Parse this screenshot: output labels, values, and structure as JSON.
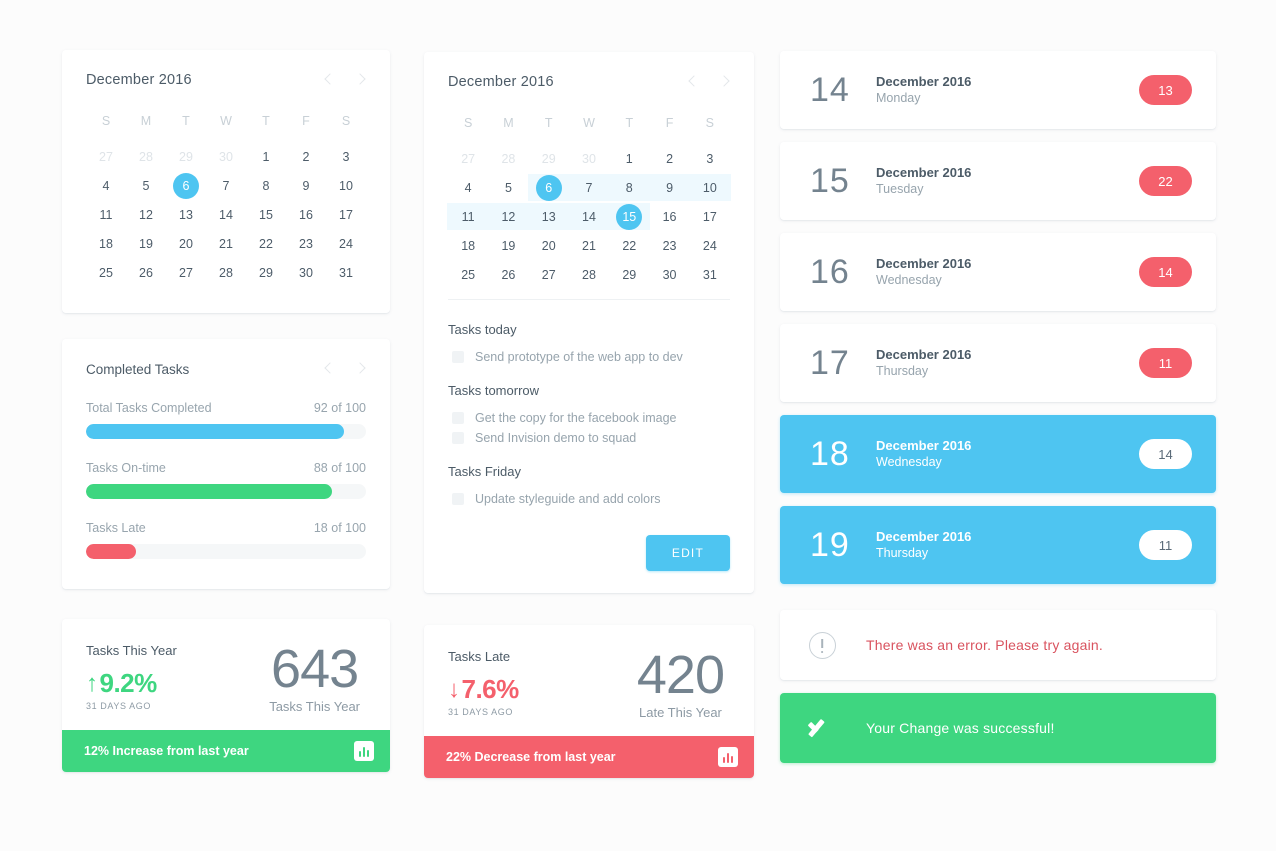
{
  "calendar_simple": {
    "title": "December 2016",
    "prev_icon": "chevron-left-icon",
    "next_icon": "chevron-right-icon",
    "dow": [
      "S",
      "M",
      "T",
      "W",
      "T",
      "F",
      "S"
    ],
    "weeks": [
      [
        {
          "d": "27",
          "muted": true
        },
        {
          "d": "28",
          "muted": true
        },
        {
          "d": "29",
          "muted": true
        },
        {
          "d": "30",
          "muted": true
        },
        {
          "d": "1"
        },
        {
          "d": "2"
        },
        {
          "d": "3"
        }
      ],
      [
        {
          "d": "4"
        },
        {
          "d": "5"
        },
        {
          "d": "6",
          "sel": true
        },
        {
          "d": "7"
        },
        {
          "d": "8"
        },
        {
          "d": "9"
        },
        {
          "d": "10"
        }
      ],
      [
        {
          "d": "11"
        },
        {
          "d": "12"
        },
        {
          "d": "13"
        },
        {
          "d": "14"
        },
        {
          "d": "15"
        },
        {
          "d": "16"
        },
        {
          "d": "17"
        }
      ],
      [
        {
          "d": "18"
        },
        {
          "d": "19"
        },
        {
          "d": "20"
        },
        {
          "d": "21"
        },
        {
          "d": "22"
        },
        {
          "d": "23"
        },
        {
          "d": "24"
        }
      ],
      [
        {
          "d": "25"
        },
        {
          "d": "26"
        },
        {
          "d": "27"
        },
        {
          "d": "28"
        },
        {
          "d": "29"
        },
        {
          "d": "30"
        },
        {
          "d": "31"
        }
      ]
    ]
  },
  "calendar_range": {
    "title": "December 2016",
    "prev_icon": "chevron-left-icon",
    "next_icon": "chevron-right-icon",
    "dow": [
      "S",
      "M",
      "T",
      "W",
      "T",
      "F",
      "S"
    ],
    "range_start": "6",
    "range_end": "15",
    "weeks": [
      [
        {
          "d": "27",
          "muted": true
        },
        {
          "d": "28",
          "muted": true
        },
        {
          "d": "29",
          "muted": true
        },
        {
          "d": "30",
          "muted": true
        },
        {
          "d": "1"
        },
        {
          "d": "2"
        },
        {
          "d": "3"
        }
      ],
      [
        {
          "d": "4"
        },
        {
          "d": "5"
        },
        {
          "d": "6",
          "sel": true,
          "range": true
        },
        {
          "d": "7",
          "range": true
        },
        {
          "d": "8",
          "range": true
        },
        {
          "d": "9",
          "range": true
        },
        {
          "d": "10",
          "range": true
        }
      ],
      [
        {
          "d": "11",
          "range": true
        },
        {
          "d": "12",
          "range": true
        },
        {
          "d": "13",
          "range": true
        },
        {
          "d": "14",
          "range": true
        },
        {
          "d": "15",
          "sel": true,
          "range": true
        },
        {
          "d": "16"
        },
        {
          "d": "17"
        }
      ],
      [
        {
          "d": "18"
        },
        {
          "d": "19"
        },
        {
          "d": "20"
        },
        {
          "d": "21"
        },
        {
          "d": "22"
        },
        {
          "d": "23"
        },
        {
          "d": "24"
        }
      ],
      [
        {
          "d": "25"
        },
        {
          "d": "26"
        },
        {
          "d": "27"
        },
        {
          "d": "28"
        },
        {
          "d": "29"
        },
        {
          "d": "30"
        },
        {
          "d": "31"
        }
      ]
    ]
  },
  "task_panel": {
    "groups": [
      {
        "title": "Tasks today",
        "items": [
          {
            "label": "Send prototype of the web app to dev",
            "checked": false
          }
        ]
      },
      {
        "title": "Tasks tomorrow",
        "items": [
          {
            "label": "Get the copy for the facebook image",
            "checked": false
          },
          {
            "label": "Send Invision demo to squad",
            "checked": false
          }
        ]
      },
      {
        "title": "Tasks Friday",
        "items": [
          {
            "label": "Update styleguide and add colors",
            "checked": false
          }
        ]
      }
    ],
    "edit_button": "EDIT"
  },
  "completed_tasks": {
    "title": "Completed Tasks",
    "prev_icon": "chevron-left-icon",
    "next_icon": "chevron-right-icon",
    "bars": [
      {
        "name": "Total Tasks Completed",
        "value": "92 of 100",
        "percent": 92,
        "color": "#4ec5f1"
      },
      {
        "name": "Tasks On-time",
        "value": "88 of 100",
        "percent": 88,
        "color": "#3ed680"
      },
      {
        "name": "Tasks Late",
        "value": "18 of 100",
        "percent": 18,
        "color": "#f4606c"
      }
    ]
  },
  "stat_tasks_year": {
    "caption": "Tasks This Year",
    "delta_arrow": "↑",
    "delta": "9.2%",
    "delta_direction": "up",
    "sub": "31 DAYS AGO",
    "big_number": "643",
    "big_label": "Tasks This Year",
    "banner_text": "12% Increase from last year",
    "banner_color": "#3ed680",
    "banner_icon": "bar-chart-icon"
  },
  "stat_tasks_late": {
    "caption": "Tasks Late",
    "delta_arrow": "↓",
    "delta": "7.6%",
    "delta_direction": "down",
    "sub": "31 DAYS AGO",
    "big_number": "420",
    "big_label": "Late This Year",
    "banner_text": "22% Decrease from last year",
    "banner_color": "#f4606c",
    "banner_icon": "bar-chart-icon"
  },
  "day_list": [
    {
      "day": "14",
      "month": "December 2016",
      "weekday": "Monday",
      "badge": "13",
      "active": false
    },
    {
      "day": "15",
      "month": "December 2016",
      "weekday": "Tuesday",
      "badge": "22",
      "active": false
    },
    {
      "day": "16",
      "month": "December 2016",
      "weekday": "Wednesday",
      "badge": "14",
      "active": false
    },
    {
      "day": "17",
      "month": "December 2016",
      "weekday": "Thursday",
      "badge": "11",
      "active": false
    },
    {
      "day": "18",
      "month": "December 2016",
      "weekday": "Wednesday",
      "badge": "14",
      "active": true
    },
    {
      "day": "19",
      "month": "December 2016",
      "weekday": "Thursday",
      "badge": "11",
      "active": true
    }
  ],
  "alerts": {
    "error": {
      "text": "There was an error. Please try again.",
      "icon": "exclamation-circle-icon",
      "color": "#d9535f"
    },
    "success": {
      "text": "Your Change was successful!",
      "icon": "check-icon",
      "color": "#3ed680"
    }
  },
  "theme": {
    "accent_blue": "#4ec5f1",
    "accent_green": "#3ed680",
    "accent_red": "#f4606c",
    "text_dark": "#4c5b67",
    "text_muted": "#97a4ad",
    "page_bg": "#fcfcfc",
    "card_bg": "#ffffff"
  }
}
